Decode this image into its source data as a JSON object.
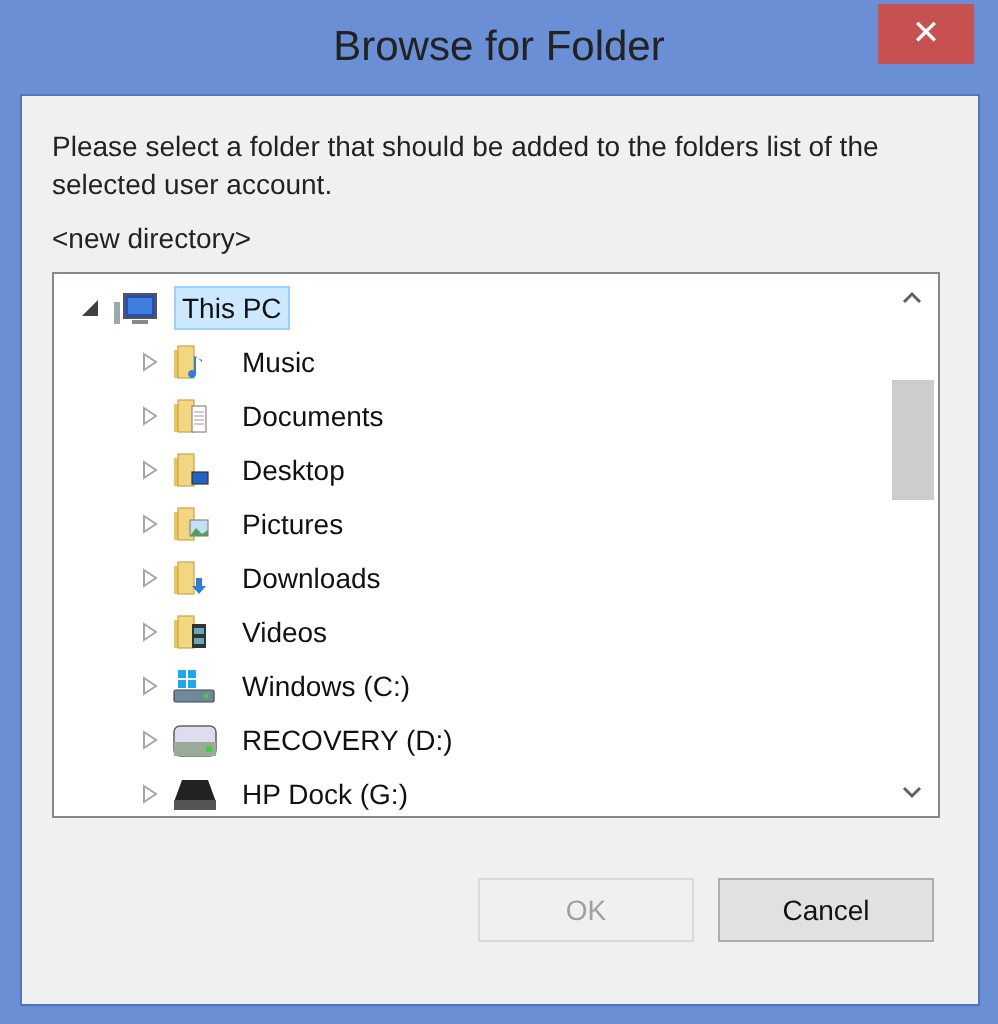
{
  "window": {
    "title": "Browse for Folder",
    "close": "✕"
  },
  "instructions": "Please select a folder that should be added to the folders list of the selected user account.",
  "current_path": "<new directory>",
  "tree": [
    {
      "label": "This PC",
      "kind": "pc",
      "expanded": true,
      "selected": true,
      "children": [
        {
          "label": "Music",
          "kind": "music",
          "expanded": false,
          "selected": false
        },
        {
          "label": "Documents",
          "kind": "documents",
          "expanded": false,
          "selected": false
        },
        {
          "label": "Desktop",
          "kind": "desktop",
          "expanded": false,
          "selected": false
        },
        {
          "label": "Pictures",
          "kind": "pictures",
          "expanded": false,
          "selected": false
        },
        {
          "label": "Downloads",
          "kind": "downloads",
          "expanded": false,
          "selected": false
        },
        {
          "label": "Videos",
          "kind": "videos",
          "expanded": false,
          "selected": false
        },
        {
          "label": "Windows (C:)",
          "kind": "system-drive",
          "expanded": false,
          "selected": false
        },
        {
          "label": "RECOVERY (D:)",
          "kind": "drive",
          "expanded": false,
          "selected": false
        },
        {
          "label": "HP Dock (G:)",
          "kind": "dock",
          "expanded": false,
          "selected": false
        }
      ]
    }
  ],
  "buttons": [
    {
      "label": "OK",
      "disabled": true
    },
    {
      "label": "Cancel",
      "disabled": false
    }
  ]
}
